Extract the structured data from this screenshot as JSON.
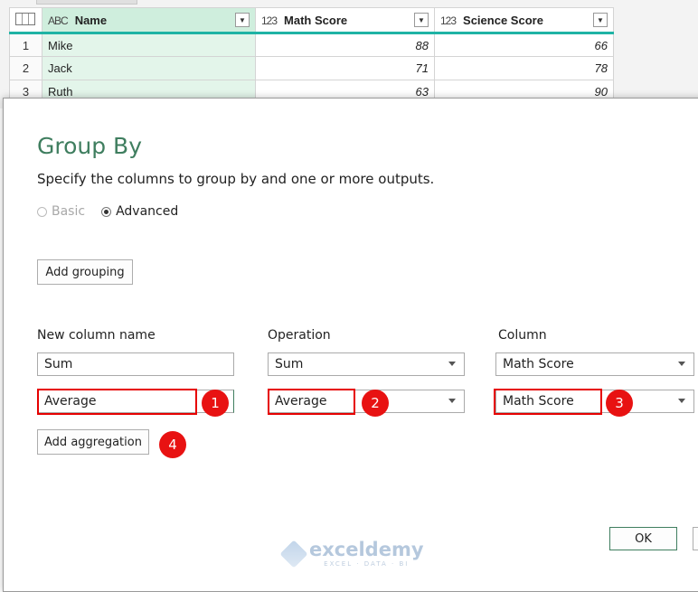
{
  "grid": {
    "columns": [
      {
        "type_icon": "ABC",
        "label": "Name"
      },
      {
        "type_icon": "123",
        "label": "Math Score"
      },
      {
        "type_icon": "123",
        "label": "Science Score"
      }
    ],
    "rows": [
      {
        "num": "1",
        "name": "Mike",
        "math": "88",
        "science": "66"
      },
      {
        "num": "2",
        "name": "Jack",
        "math": "71",
        "science": "78"
      },
      {
        "num": "3",
        "name": "Ruth",
        "math": "63",
        "science": "90"
      }
    ]
  },
  "dialog": {
    "title": "Group By",
    "subtitle": "Specify the columns to group by and one or more outputs.",
    "radio_basic": "Basic",
    "radio_advanced": "Advanced",
    "mode_selected": "Advanced",
    "add_grouping": "Add grouping",
    "headers": {
      "new_column_name": "New column name",
      "operation": "Operation",
      "column": "Column"
    },
    "aggregations": [
      {
        "name": "Sum",
        "operation": "Sum",
        "column": "Math Score"
      },
      {
        "name": "Average",
        "operation": "Average",
        "column": "Math Score"
      }
    ],
    "add_aggregation": "Add aggregation",
    "ok": "OK"
  },
  "annotations": {
    "badges": [
      "1",
      "2",
      "3",
      "4"
    ],
    "highlight_color": "#e60000",
    "badge_color": "#e81212"
  },
  "watermark": {
    "name": "exceldemy",
    "tagline": "EXCEL · DATA · BI"
  },
  "colors": {
    "accent": "#3f7e5f",
    "header_underline": "#1fb3a5",
    "selected_column": "#e3f5ea"
  }
}
